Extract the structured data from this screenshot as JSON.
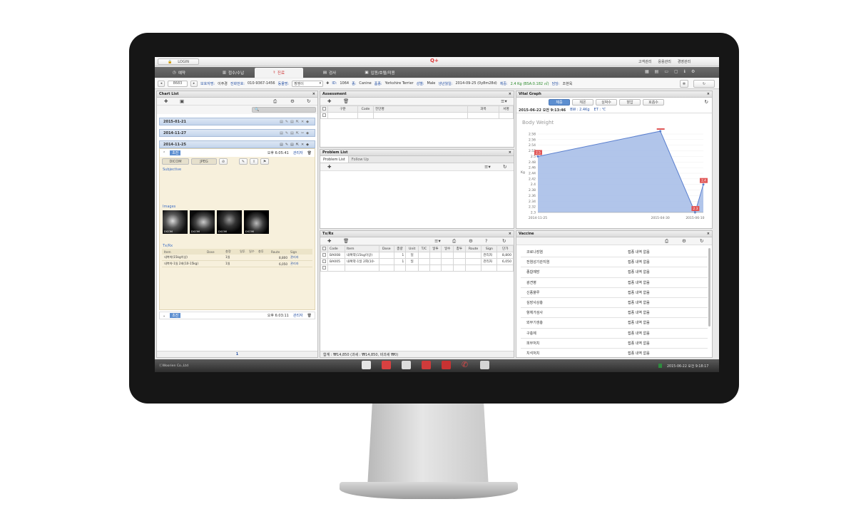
{
  "topbar": {
    "login": "LOGIN",
    "links": [
      "고객관리",
      "응용관리",
      "경영관리"
    ]
  },
  "nav": {
    "tabs": [
      "예약",
      "접수/수납",
      "진료",
      "검사",
      "입원/호텔/미용"
    ],
    "active": 2
  },
  "patient": {
    "chart_no": "8683",
    "owner_label": "보호자명:",
    "owner": "이주경",
    "phone_label": "전화번호:",
    "phone": "010-9367-1456",
    "animal_label": "동물명:",
    "animal": "짱짱이",
    "id_label": "ID:",
    "id": "1064",
    "species_label": "종:",
    "species": "Canine",
    "breed_label": "품종:",
    "breed": "Yorkshire Terrier",
    "sex_label": "성별:",
    "sex": "Male",
    "birth_label": "생년월일:",
    "birth": "2014-09-25 (0y8m28d)",
    "weight_label": "체중:",
    "weight": "2.4 Kg (BSA:0.182 ㎡)",
    "vet_label": "담당:",
    "vet": "조현욱"
  },
  "chart_list": {
    "title": "Chart List",
    "dates": [
      "2015-01-21",
      "2014-11-27",
      "2014-11-25"
    ],
    "visit": {
      "status": "초진",
      "time": "오후 6:05:41",
      "staff": "관리자"
    },
    "file_tabs": [
      "DICOM",
      "JPEG"
    ],
    "subjective": "Subjective",
    "images_label": "Images",
    "image_caption": "DICOM",
    "txrx_label": "Tx/Rx",
    "tx_headers": [
      "Item",
      "Dose",
      "총량",
      "일투",
      "일수",
      "총투",
      "Route",
      "Sign"
    ],
    "tx_rows": [
      {
        "item": "내복약(15kg이상)",
        "total": "1일",
        "price": "8,800",
        "sign": "관리자"
      },
      {
        "item": "내복약-1일 2회(10-15kg)",
        "total": "1일",
        "price": "6,050",
        "sign": "관리자"
      }
    ],
    "visit2": {
      "status": "초진",
      "time": "오후 6:03:11",
      "staff": "관리자"
    },
    "page": "1"
  },
  "assessment": {
    "title": "Assessment",
    "headers": [
      "구분",
      "Code",
      "진단명",
      "과목",
      "서명"
    ]
  },
  "problem": {
    "title": "Problem List",
    "tabs": [
      "Problem List",
      "Follow Up"
    ]
  },
  "txrx": {
    "title": "Tx/Rx",
    "headers": [
      "Code",
      "Item",
      "Dose",
      "총량",
      "Unit",
      "T/C",
      "일투",
      "일수",
      "총투",
      "Route",
      "Sign",
      "단가"
    ],
    "rows": [
      {
        "code": "BA008",
        "item": "내복약(15kg이상)",
        "total": "1",
        "unit": "일",
        "sign": "관리자",
        "price": "8,800"
      },
      {
        "code": "BA005",
        "item": "내복약-1일 2회(10-",
        "total": "1",
        "unit": "일",
        "sign": "관리자",
        "price": "6,050"
      }
    ],
    "footer": "합계 : ₩14,850 (과세 : ₩14,850, 비과세 ₩0)"
  },
  "vital": {
    "title": "Vital Graph",
    "tabs": [
      "체중",
      "체온",
      "심박수",
      "혈압",
      "호흡수"
    ],
    "active_tab": 0,
    "datetime": "2015-06-22 오전 9:13:46",
    "bw": "BW : 2.4Kg",
    "et": "ET : ℃"
  },
  "chart_data": {
    "type": "area",
    "title": "Body Weight",
    "ylabel": "Kg",
    "x": [
      "2014-11-25",
      "2015-04-30",
      "2015-06-10",
      ""
    ],
    "x_ticks": [
      "2014-11-25",
      "2015-04-30",
      "2015-06-10"
    ],
    "values": [
      2.5,
      2.6,
      2.3,
      2.4
    ],
    "ylim": [
      2.3,
      2.58
    ],
    "y_ticks": [
      "2.58",
      "2.56",
      "2.54",
      "2.52",
      "2.5",
      "2.48",
      "2.46",
      "2.44",
      "2.42",
      "2.4",
      "2.38",
      "2.36",
      "2.34",
      "2.32",
      "2.3"
    ],
    "point_labels": [
      "2.5",
      "2.6",
      "2.3",
      "2.4"
    ],
    "colors": {
      "fill": "#a9bfe8",
      "line": "#5a7fce",
      "label": "#e05656"
    }
  },
  "vaccine": {
    "title": "Vaccine",
    "items": [
      "코로나장염",
      "전염성기관지염",
      "종합예방",
      "광견병",
      "신종플루",
      "심장사상충",
      "항체가검사",
      "외부기생충",
      "구충제",
      "피부처치",
      "치석처치"
    ],
    "status": "접종 내역 없음"
  },
  "taskbar": {
    "company": "ⓒWoorien Co.,Ltd",
    "datetime": "2015-06-22 오전 9:18:17"
  }
}
